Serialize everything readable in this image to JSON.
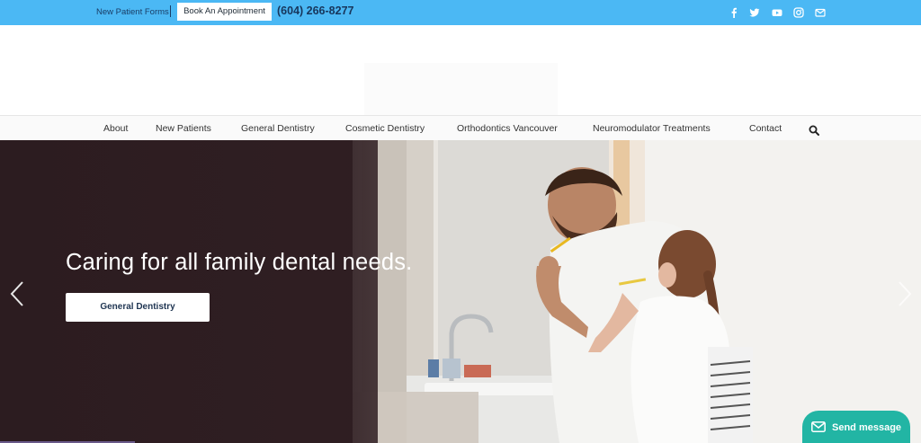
{
  "topbar": {
    "forms_link": "New Patient Forms",
    "book_button": "Book An Appointment",
    "phone": "(604) 266-8277",
    "social_icons": [
      "facebook-icon",
      "twitter-icon",
      "youtube-icon",
      "instagram-icon",
      "email-icon"
    ]
  },
  "nav": {
    "items": [
      "About",
      "New Patients",
      "General Dentistry",
      "Cosmetic Dentistry",
      "Orthodontics Vancouver",
      "Neuromodulator Treatments",
      "Contact"
    ],
    "search_icon": "search-icon"
  },
  "hero": {
    "title": "Caring for all family dental needs.",
    "button": "General Dentistry"
  },
  "chat": {
    "label": "Send message"
  },
  "colors": {
    "topbar": "#4bb8f4",
    "hero_dark": "#2c1c20",
    "chat": "#22b5a4",
    "phone": "#17365c"
  }
}
